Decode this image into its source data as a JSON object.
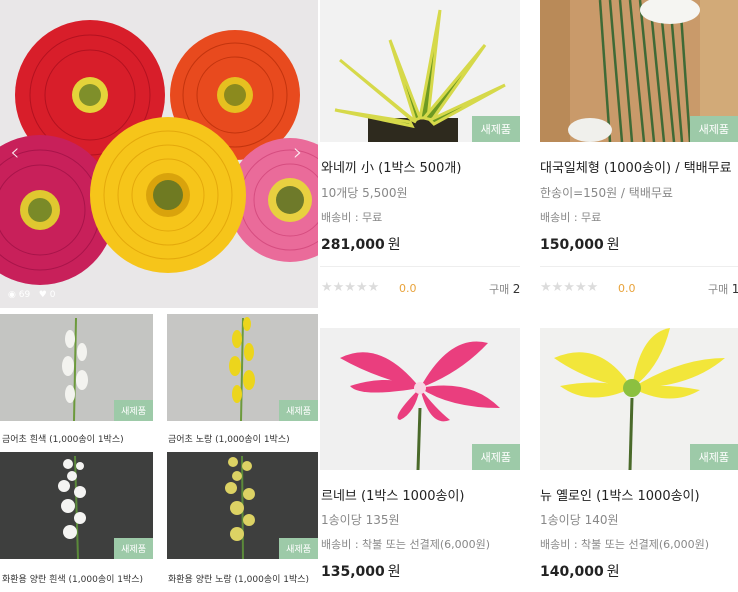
{
  "hero": {
    "views": "69",
    "likes": "0",
    "prev_icon": "chevron-left-icon",
    "next_icon": "chevron-right-icon"
  },
  "small_products": [
    {
      "caption": "금어초 흰색 (1,000송이 1박스)",
      "badge": "새제품"
    },
    {
      "caption": "금어초 노랑 (1,000송이 1박스)",
      "badge": "새제품"
    },
    {
      "caption": "화환용 양란 흰색 (1,000송이 1박스)",
      "badge": "새제품"
    },
    {
      "caption": "화환용 양란 노랑 (1,000송이 1박스)",
      "badge": "새제품"
    }
  ],
  "products": [
    {
      "title": "와네끼 小 (1박스 500개)",
      "sub": "10개당 5,500원",
      "ship": "배송비 : 무료",
      "price": "281,000",
      "unit": "원",
      "rating": "0.0",
      "buy_label": "구매",
      "buy_count": "2",
      "badge": "새제품"
    },
    {
      "title": "대국일체형 (1000송이) / 택배무료",
      "sub": "한송이=150원 / 택배무료",
      "ship": "배송비 : 무료",
      "price": "150,000",
      "unit": "원",
      "rating": "0.0",
      "buy_label": "구매",
      "buy_count": "1",
      "badge": "새제품"
    },
    {
      "title": "르네브 (1박스 1000송이)",
      "sub": "1송이당 135원",
      "ship": "배송비 : 착불 또는 선결제(6,000원)",
      "price": "135,000",
      "unit": "원",
      "badge": "새제품"
    },
    {
      "title": "뉴 옐로인 (1박스 1000송이)",
      "sub": "1송이당 140원",
      "ship": "배송비 : 착불 또는 선결제(6,000원)",
      "price": "140,000",
      "unit": "원",
      "badge": "새제품"
    }
  ],
  "stars": "★★★★★",
  "colors": {
    "badge": "#9dcaa8",
    "rating": "#e8a33c"
  }
}
